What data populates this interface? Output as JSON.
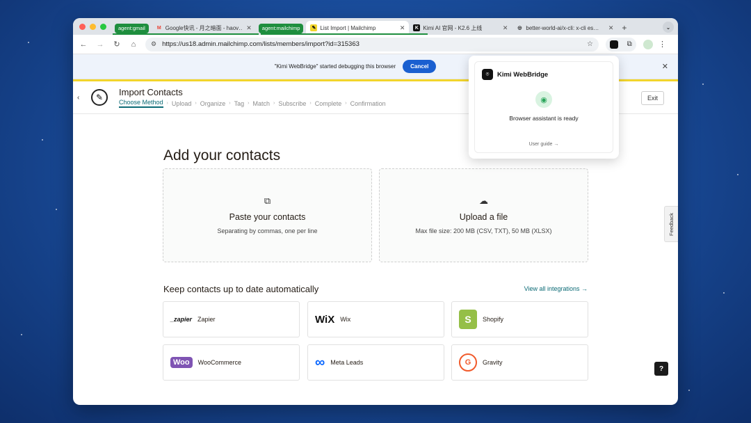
{
  "tabs": [
    {
      "group": "agent:gmail",
      "favicon": "M",
      "favicon_color": "#ea4335",
      "title": "Google快讯 - 月之暗面 - haov…",
      "close": "✕"
    },
    {
      "group": "agent:mailchimp",
      "favicon": "✎",
      "favicon_color": "#f2d52c",
      "title": "List Import | Mailchimp",
      "close": "✕",
      "active": true
    },
    {
      "favicon": "K",
      "favicon_color": "#111111",
      "title": "Kimi AI 官网 - K2.6 上线",
      "close": "✕"
    },
    {
      "favicon": "◎",
      "favicon_color": "#111111",
      "title": "better-world-ai/x-cli: x-cli es…",
      "close": "✕"
    }
  ],
  "new_tab": "+",
  "tab_menu": "⌄",
  "toolbar": {
    "back": "←",
    "forward": "→",
    "reload": "↻",
    "home": "⌂",
    "url": "https://us18.admin.mailchimp.com/lists/members/import?id=315363",
    "bookmark": "☆",
    "puzzle": "⧉",
    "menu": "⋮"
  },
  "debug_bar": {
    "message": "\"Kimi WebBridge\" started debugging this browser",
    "cancel": "Cancel",
    "close": "✕"
  },
  "header": {
    "back": "‹",
    "title": "Import Contacts",
    "steps": [
      "Choose Method",
      "Upload",
      "Organize",
      "Tag",
      "Match",
      "Subscribe",
      "Complete",
      "Confirmation"
    ],
    "step_sep": "›",
    "exit": "Exit"
  },
  "main": {
    "heading": "Add your contacts",
    "cards": [
      {
        "icon": "⧉",
        "title": "Paste your contacts",
        "subtitle": "Separating by commas, one per line"
      },
      {
        "icon": "☁",
        "title": "Upload a file",
        "subtitle": "Max file size: 200 MB (CSV, TXT), 50 MB (XLSX)"
      }
    ],
    "integrations_heading": "Keep contacts up to date automatically",
    "view_all": "View all integrations →",
    "integrations": [
      {
        "logo": "_zapier",
        "name": "Zapier",
        "color": "#ff4a00"
      },
      {
        "logo": "WiX",
        "name": "Wix",
        "color": "#111111"
      },
      {
        "logo": "S",
        "name": "Shopify",
        "color": "#95bf47"
      },
      {
        "logo": "Woo",
        "name": "WooCommerce",
        "color": "#7f54b3"
      },
      {
        "logo": "∞",
        "name": "Meta Leads",
        "color": "#0866ff"
      },
      {
        "logo": "G",
        "name": "Gravity",
        "color": "#f15a2b"
      }
    ],
    "feedback": "Feedback",
    "help": "?"
  },
  "popup": {
    "logo": "⌾",
    "title": "Kimi WebBridge",
    "status": "Browser assistant is ready",
    "guide": "User guide →"
  }
}
